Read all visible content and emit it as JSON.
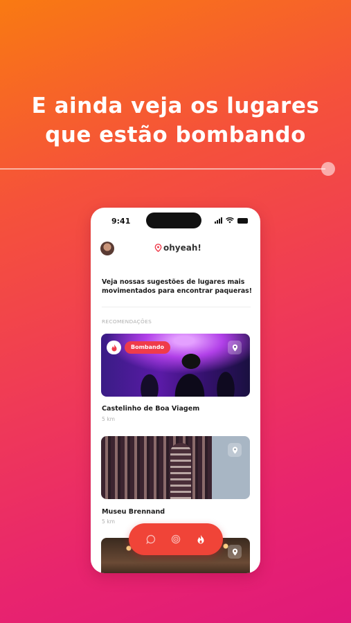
{
  "headline": {
    "line1": "E ainda veja os lugares",
    "line2": "que estão bombando"
  },
  "status_bar": {
    "time": "9:41"
  },
  "app": {
    "logo_text": "ohyeah!",
    "intro": "Veja nossas sugestões de lugares mais movimentados para encontrar paqueras!",
    "section_label": "RECOMENDAÇÕES"
  },
  "cards": [
    {
      "title": "Castelinho de Boa Viagem",
      "distance": "5 km",
      "badge": "Bombando"
    },
    {
      "title": "Museu Brennand",
      "distance": "5 km"
    }
  ],
  "tabbar": {
    "tabs": [
      {
        "icon": "chat-icon"
      },
      {
        "icon": "radar-icon"
      },
      {
        "icon": "fire-icon",
        "active": true
      }
    ]
  },
  "colors": {
    "accent": "#f04438",
    "badge": "#ef3b4a",
    "gradient_top": "#f97a12",
    "gradient_bottom": "#e0197a"
  }
}
